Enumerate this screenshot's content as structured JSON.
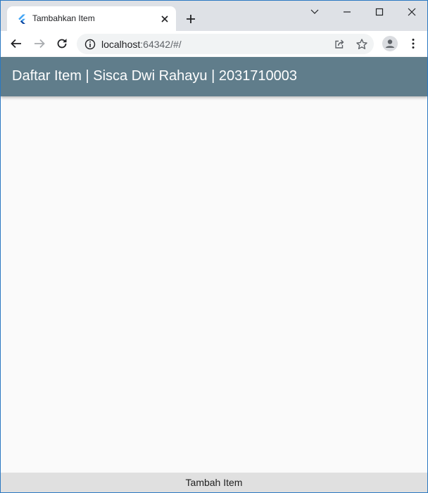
{
  "browser": {
    "tab": {
      "title": "Tambahkan Item",
      "favicon": "flutter-icon"
    },
    "address": {
      "host": "localhost",
      "rest": ":64342/#/"
    },
    "icons": {
      "back": "arrow-left-icon",
      "forward": "arrow-right-icon",
      "reload": "reload-icon",
      "site_info": "info-icon",
      "share": "share-icon",
      "bookmark": "star-icon",
      "profile": "account-icon",
      "menu": "more-vert-icon"
    }
  },
  "app": {
    "title": "Daftar Item | Sisca Dwi Rahayu | 2031710003",
    "add_button_label": "Tambah Item"
  },
  "colors": {
    "appbar": "#607d8b",
    "background": "#fafafa",
    "bottom_button": "#e0e0e0",
    "window_border": "#2b78c2"
  }
}
